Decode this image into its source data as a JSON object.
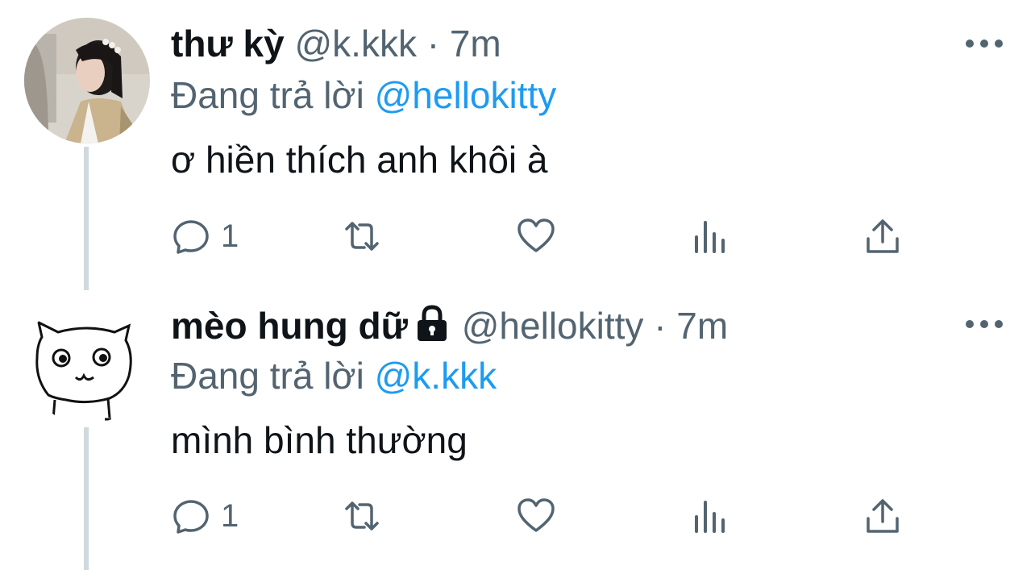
{
  "tweets": [
    {
      "name": "thư kỳ",
      "handle": "@k.kkk",
      "separator": "·",
      "time": "7m",
      "replying_prefix": "Đang trả lời",
      "replying_to": "@hellokitty",
      "text": "ơ hiền thích anh khôi à",
      "protected": false,
      "avatar_icon": "photo-avatar",
      "actions": {
        "reply_count": "1",
        "retweet_count": "",
        "like_count": ""
      }
    },
    {
      "name": "mèo hung dữ",
      "handle": "@hellokitty",
      "separator": "·",
      "time": "7m",
      "replying_prefix": "Đang trả lời",
      "replying_to": "@k.kkk",
      "text": "mình bình thường",
      "protected": true,
      "avatar_icon": "cat-doodle-avatar",
      "actions": {
        "reply_count": "1",
        "retweet_count": "",
        "like_count": ""
      }
    }
  ],
  "colors": {
    "text": "#0f1419",
    "secondary": "#536471",
    "link": "#1d9bf0",
    "thread_line": "#cfd9de"
  }
}
